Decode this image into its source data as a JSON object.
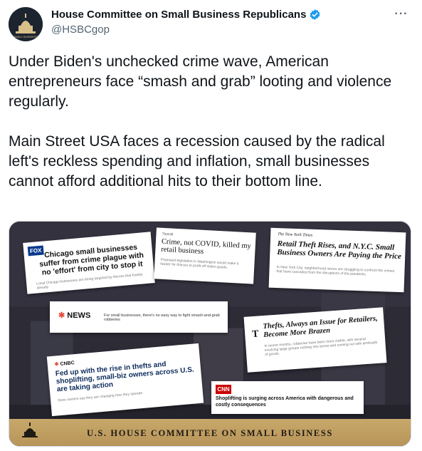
{
  "account": {
    "display_name": "House Committee on Small Business Republicans",
    "handle": "@HSBCgop",
    "verified_icon": "verified-badge-icon",
    "more_icon": "more-options-icon",
    "avatar_text": "SMALL BUSINESS"
  },
  "tweet": {
    "text": "Under Biden's unchecked crime wave, American entrepreneurs face “smash and grab” looting and violence regularly.\n\nMain Street USA faces a recession caused by the radical left's reckless spending and inflation, small businesses cannot afford additional hits to their bottom line."
  },
  "media": {
    "footer_text": "U.S. HOUSE COMMITTEE ON SMALL BUSINESS",
    "clippings": {
      "fox": {
        "logo": "FOX",
        "headline": "Chicago small businesses suffer from crime plague with no 'effort' from city to stop it",
        "body": "Local Chicago businesses are being targeted by thieves that frankly already"
      },
      "crime": {
        "pub": "TheHill",
        "headline": "Crime, not COVID, killed my retail business",
        "body": "Proposed legislation in Washington would make it harder for thieves to profit off stolen goods."
      },
      "nyt": {
        "pub": "The New York Times",
        "headline": "Retail Theft Rises, and N.Y.C. Small Business Owners Are Paying the Price",
        "body": "In New York City, neighborhood stores are struggling to confront the crimes that have cascaded from the disruptions of the pandemic."
      },
      "nbc": {
        "logo": "NEWS",
        "sub": "For small businesses, there's no easy way to fight smash-and-grab robberies"
      },
      "thefts": {
        "logo": "T",
        "headline": "Thefts, Always an Issue for Retailers, Become More Brazen",
        "body": "In recent months, robberies have been more visible, with several involving large groups rushing into stores and coming out with armloads of goods."
      },
      "cnbc": {
        "logo": "CNBC",
        "headline": "Fed up with the rise in thefts and shoplifting, small-biz owners across U.S. are taking action",
        "body": "Store owners say they are changing how they operate"
      },
      "cnn": {
        "logo": "CNN",
        "headline": "Shoplifting is surging across America with dangerous and costly consequences"
      }
    }
  },
  "colors": {
    "verified": "#1d9bf0",
    "footer_gold": "#c8a86a"
  }
}
